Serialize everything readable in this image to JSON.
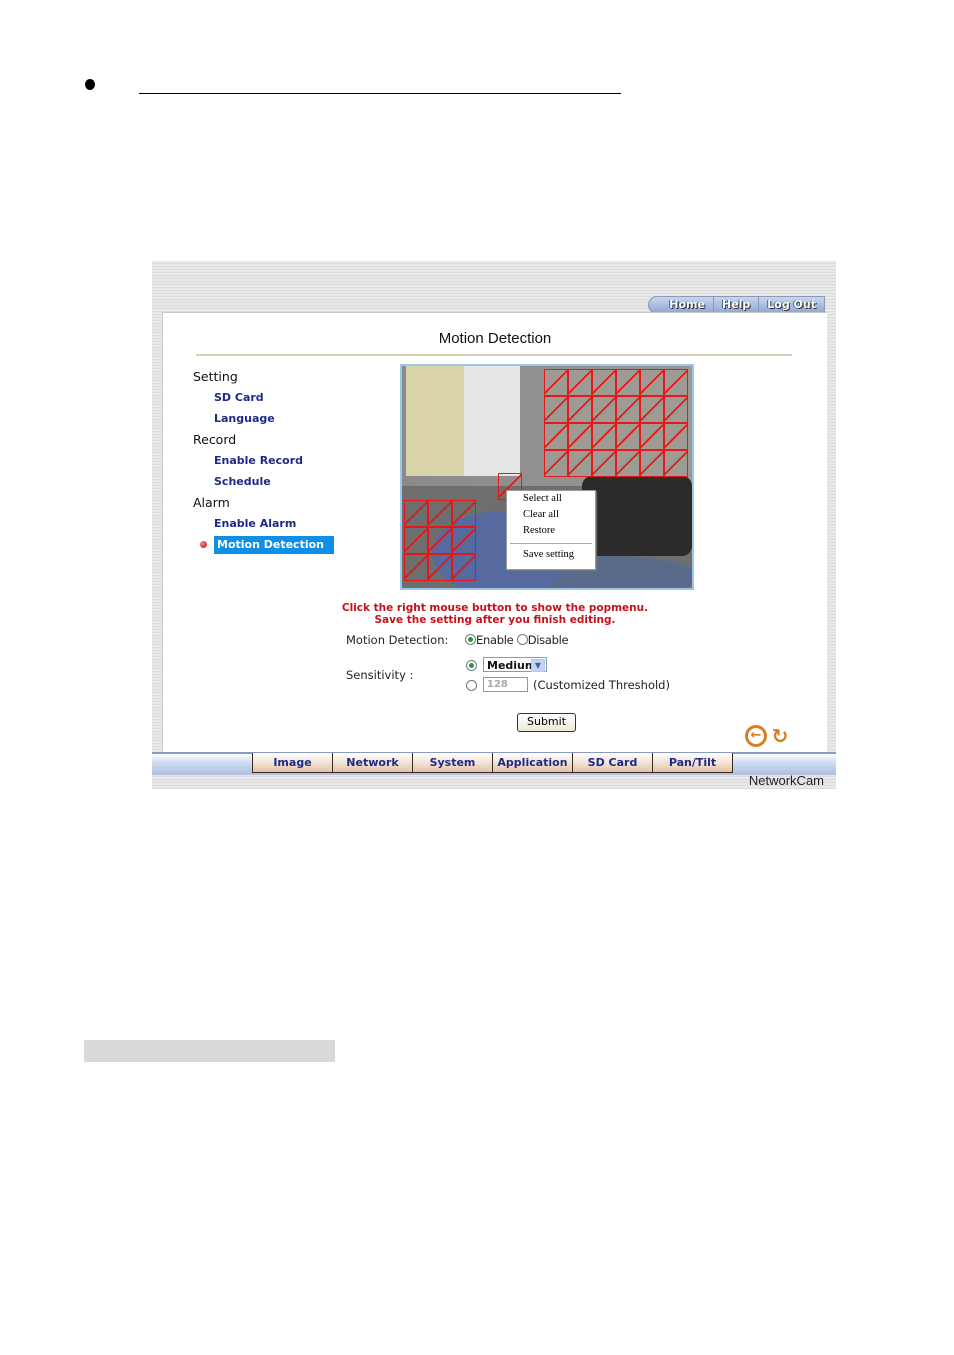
{
  "document": {
    "bullet_visible": true
  },
  "app": {
    "top_nav": [
      "Home",
      "Help",
      "Log Out"
    ],
    "page_title": "Motion Detection",
    "sidebar": [
      {
        "type": "section",
        "label": "Setting"
      },
      {
        "type": "item",
        "label": "SD Card"
      },
      {
        "type": "item",
        "label": "Language"
      },
      {
        "type": "section",
        "label": "Record"
      },
      {
        "type": "item",
        "label": "Enable Record"
      },
      {
        "type": "item",
        "label": "Schedule"
      },
      {
        "type": "section",
        "label": "Alarm"
      },
      {
        "type": "item",
        "label": "Enable Alarm"
      },
      {
        "type": "item",
        "label": "Motion Detection",
        "active": true
      }
    ],
    "context_menu": {
      "items": [
        "Select all",
        "Clear all",
        "Restore",
        "Save setting"
      ]
    },
    "hints": [
      "Click the right mouse button to show the popmenu.",
      "Save the setting after you finish editing."
    ],
    "motion_detection": {
      "label": "Motion Detection:",
      "options": [
        "Enable",
        "Disable"
      ],
      "selected": "Enable"
    },
    "sensitivity": {
      "label": "Sensitivity :",
      "selected_mode": "preset",
      "preset_value": "Medium",
      "threshold_value": "128",
      "threshold_label": "(Customized Threshold)"
    },
    "submit_label": "Submit",
    "icons": [
      "back-arrow-icon",
      "refresh-icon"
    ],
    "bottom_tabs": [
      "Image",
      "Network",
      "System",
      "Application",
      "SD Card",
      "Pan/Tilt"
    ],
    "brand": "NetworkCam"
  }
}
